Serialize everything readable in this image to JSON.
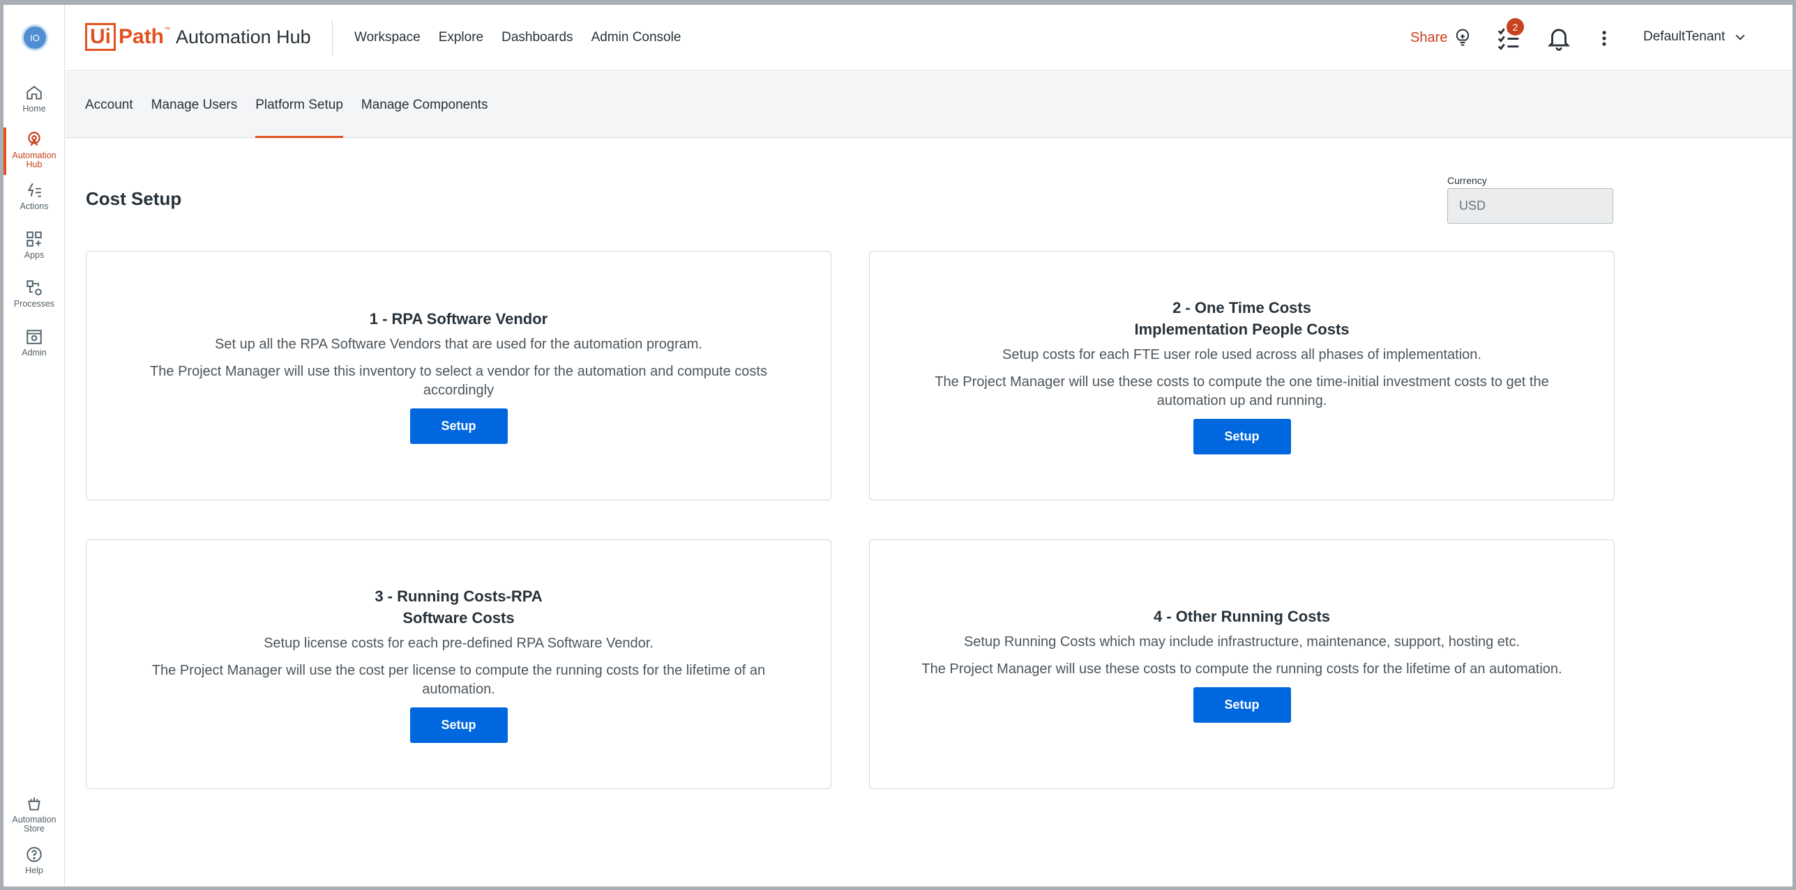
{
  "rail": {
    "avatar": "IO",
    "items": [
      {
        "label": "Home",
        "icon": "home-icon"
      },
      {
        "label": "Automation Hub",
        "icon": "automation-hub-icon"
      },
      {
        "label": "Actions",
        "icon": "actions-icon"
      },
      {
        "label": "Apps",
        "icon": "apps-icon"
      },
      {
        "label": "Processes",
        "icon": "processes-icon"
      },
      {
        "label": "Admin",
        "icon": "admin-icon"
      },
      {
        "label": "Automation Store",
        "icon": "automation-store-icon"
      },
      {
        "label": "Help",
        "icon": "help-icon"
      }
    ]
  },
  "header": {
    "logo_ui": "Ui",
    "logo_path": "Path",
    "logo_tm": "™",
    "product": "Automation Hub",
    "nav": [
      "Workspace",
      "Explore",
      "Dashboards",
      "Admin Console"
    ],
    "share_label": "Share",
    "tasks_badge": "2",
    "tenant": "DefaultTenant"
  },
  "subtabs": [
    "Account",
    "Manage Users",
    "Platform Setup",
    "Manage Components"
  ],
  "main": {
    "title": "Cost Setup",
    "currency_label": "Currency",
    "currency_value": "USD",
    "cards": [
      {
        "title_line1": "1 - RPA Software Vendor",
        "title_line2": "",
        "desc": "Set up all the RPA Software Vendors that are used for the automation program.",
        "desc2": "The Project Manager will use this inventory to select a vendor for the automation and compute costs accordingly",
        "button": "Setup"
      },
      {
        "title_line1": "2 - One Time Costs",
        "title_line2": "Implementation People Costs",
        "desc": "Setup costs for each FTE user role used across all phases of implementation.",
        "desc2": "The Project Manager will use these costs to compute the one time-initial investment costs to get the automation up and running.",
        "button": "Setup"
      },
      {
        "title_line1": "3 - Running Costs-RPA",
        "title_line2": "Software Costs",
        "desc": "Setup license costs for each pre-defined RPA Software Vendor.",
        "desc2": "The Project Manager will use the cost per license to compute the running costs for the lifetime of an automation.",
        "button": "Setup"
      },
      {
        "title_line1": "4 - Other Running Costs",
        "title_line2": "",
        "desc": "Setup Running Costs which may include infrastructure, maintenance, support, hosting etc.",
        "desc2": "The Project Manager will use these costs to compute the running costs for the lifetime of an automation.",
        "button": "Setup"
      }
    ]
  },
  "colors": {
    "accent": "#e05220",
    "primary_button": "#0067df"
  }
}
